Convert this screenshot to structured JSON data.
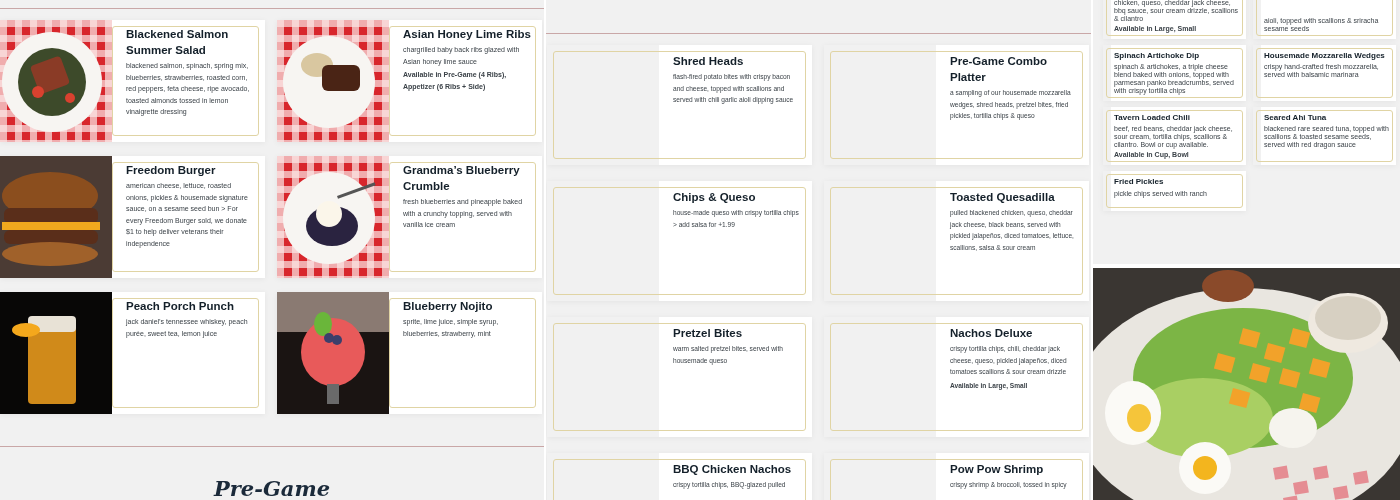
{
  "panels": [
    {
      "kind": "large",
      "items": [
        {
          "name": "Blackened Salmon Summer Salad",
          "description": "blackened salmon, spinach, spring mix, blueberries, strawberries, roasted corn, red peppers, feta cheese, ripe avocado, toasted almonds tossed in lemon vinaigrette dressing",
          "photo": true
        },
        {
          "name": "Asian Honey Lime Ribs",
          "description": "chargrilled baby back ribs glazed with Asian honey lime sauce",
          "note": "Available in Pre-Game (4 Ribs), Appetizer (6 Ribs + Side)",
          "photo": true
        },
        {
          "name": "Freedom Burger",
          "description": "american cheese, lettuce, roasted onions, pickles & housemade signature sauce, on a sesame seed bun > For every Freedom Burger sold, we donate $1 to help deliver veterans their independence",
          "photo": true
        },
        {
          "name": "Grandma’s Blueberry Crumble",
          "description": "fresh blueberries and pineapple baked with a crunchy topping, served with vanilla ice cream",
          "photo": true
        },
        {
          "name": "Peach Porch Punch",
          "description": "jack daniel’s tennessee whiskey, peach purée, sweet tea, lemon juice",
          "photo": true
        },
        {
          "name": "Blueberry Nojito",
          "description": "sprite, lime juice, simple syrup, blueberries, strawberry, mint",
          "photo": true
        }
      ],
      "heading": "Pre-Game"
    },
    {
      "kind": "medium",
      "items": [
        {
          "name": "Shred Heads",
          "description": "flash-fired potato bites with crispy bacon and cheese, topped with scallions and served with chili garlic aioli dipping sauce",
          "photo": false
        },
        {
          "name": "Pre-Game Combo Platter",
          "description": "a sampling of our housemade mozzarella wedges, shred heads, pretzel bites, fried pickles, tortilla chips & queso",
          "photo": false
        },
        {
          "name": "Chips & Queso",
          "description": "house-made queso with crispy tortilla chips > add salsa for +1.99",
          "photo": false
        },
        {
          "name": "Toasted Quesadilla",
          "description": "pulled blackened chicken, queso, cheddar jack cheese, black beans, served with pickled jalapeños, diced tomatoes, lettuce, scallions, salsa & sour cream",
          "photo": false
        },
        {
          "name": "Pretzel Bites",
          "description": "warm salted pretzel bites, served with housemade queso",
          "photo": false
        },
        {
          "name": "Nachos Deluxe",
          "description": "crispy tortilla chips, chili, cheddar jack cheese, queso, pickled jalapeños, diced tomatoes scallions & sour cream drizzle",
          "note": "Available in Large, Small",
          "photo": false
        },
        {
          "name": "BBQ Chicken Nachos",
          "description": "crispy tortilla chips, BBQ-glazed pulled",
          "photo": false
        },
        {
          "name": "Pow Pow Shrimp",
          "description": "crispy shrimp & broccoli, tossed in spicy",
          "photo": false
        }
      ]
    },
    {
      "kind": "small",
      "items": [
        {
          "description": "chicken, queso, cheddar jack cheese, bbq sauce, sour cream drizzle, scallions & cilantro",
          "note": "Available in Large, Small",
          "photo": false
        },
        {
          "description": "aioli, topped with scallions & sriracha sesame seeds",
          "photo": false
        },
        {
          "name": "Spinach Artichoke Dip",
          "description": "spinach & artichokes, a triple cheese blend baked with onions, topped with parmesan panko breadcrumbs, served with crispy tortilla chips",
          "photo": false
        },
        {
          "name": "Housemade Mozzarella Wedges",
          "description": "crispy hand-crafted fresh mozzarella, served with balsamic marinara",
          "photo": false
        },
        {
          "name": "Tavern Loaded Chili",
          "description": "beef, red beans, cheddar jack cheese, sour cream, tortilla chips, scallions & cilantro. Bowl or cup available.",
          "note": "Available in Cup, Bowl",
          "photo": false
        },
        {
          "name": "Seared Ahi Tuna",
          "description": "blackened rare seared tuna, topped with scallions & toasted sesame seeds, served with red dragon sauce",
          "photo": false
        },
        {
          "name": "Fried Pickles",
          "description": "pickle chips served with ranch",
          "photo": false
        }
      ]
    }
  ]
}
